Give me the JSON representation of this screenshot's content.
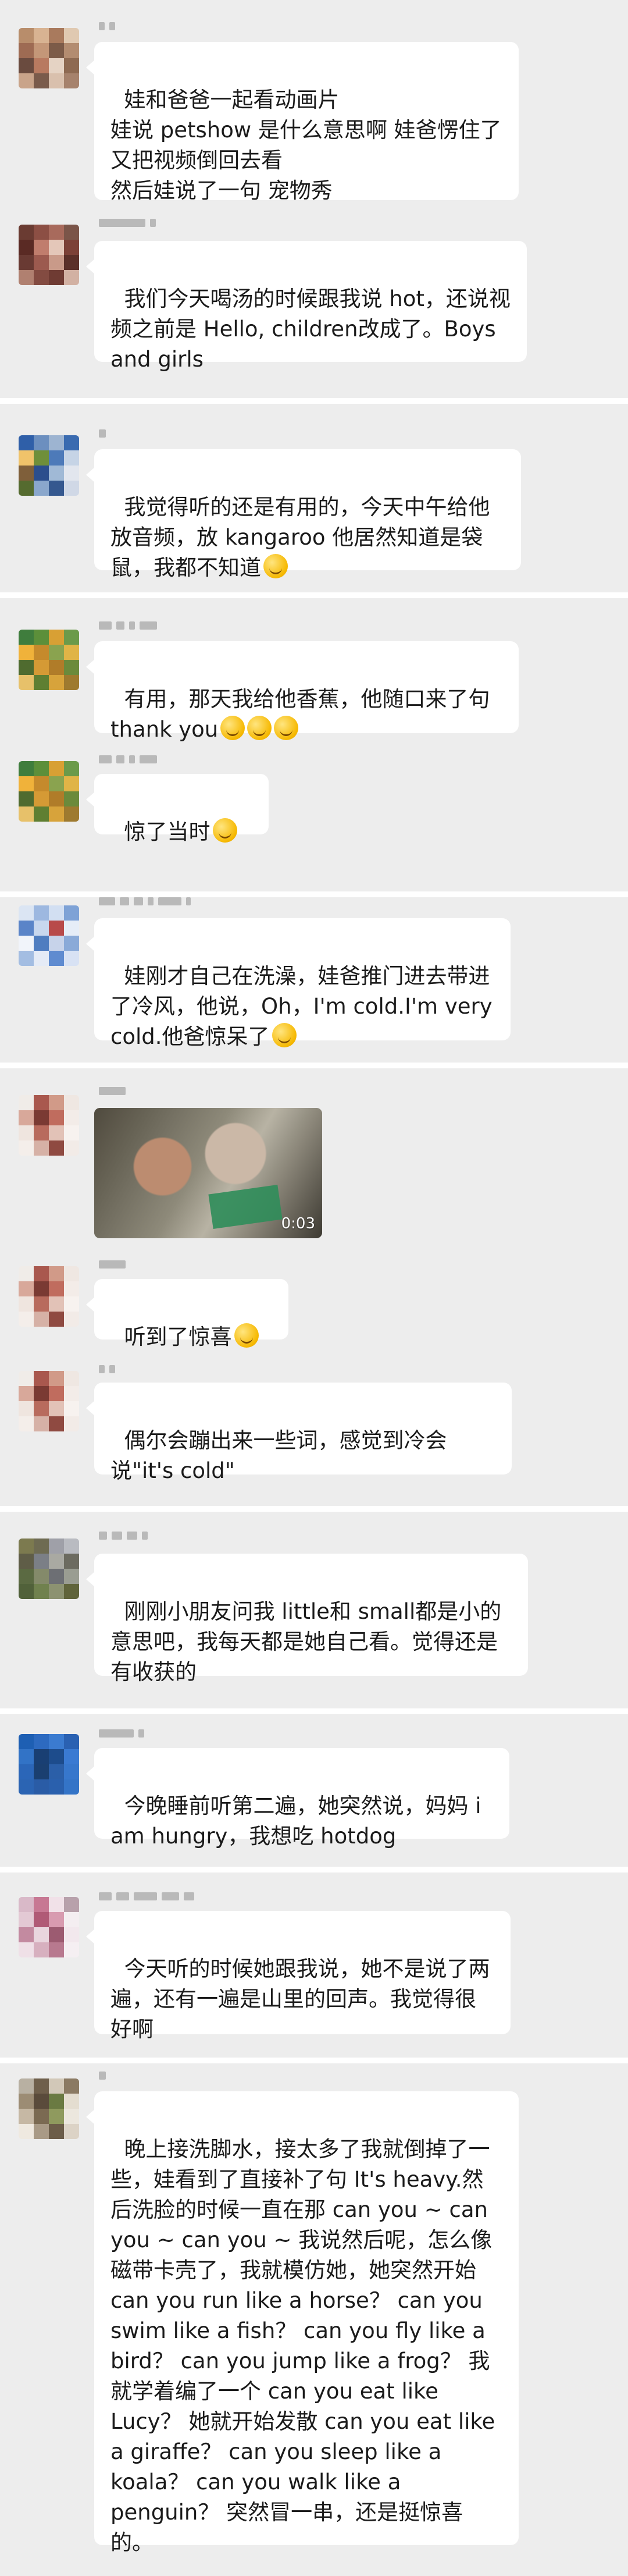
{
  "messages": [
    {
      "text": "娃和爸爸一起看动画片\n娃说 petshow 是什么意思啊 娃爸愣住了 又把视频倒回去看\n然后娃说了一句 宠物秀"
    },
    {
      "text": "我们今天喝汤的时候跟我说 hot，还说视频之前是 Hello, children改成了。Boys and girls"
    },
    {
      "text": "我觉得听的还是有用的，今天中午给他放音频，放 kangaroo 他居然知道是袋鼠，我都不知道",
      "emoji": "laugh-cry-emoji"
    },
    {
      "text": "有用，那天我给他香蕉，他随口来了句 thank you",
      "emoji": "laugh-cry-emoji"
    },
    {
      "text": "惊了当时",
      "emoji": "face-palm-emoji"
    },
    {
      "text": "娃刚才自己在洗澡，娃爸推门进去带进了冷风，他说，Oh，I'm cold.I'm very cold.他爸惊呆了",
      "emoji": "exploding-head-emoji"
    },
    {
      "video_duration": "0:03"
    },
    {
      "text": "听到了惊喜",
      "emoji": "grin-emoji"
    },
    {
      "text": "偶尔会蹦出来一些词，感觉到冷会说\"it's cold\""
    },
    {
      "text": "刚刚小朋友问我 little和 small都是小的意思吧，我每天都是她自己看。觉得还是有收获的"
    },
    {
      "text": "今晚睡前听第二遍，她突然说，妈妈 i am hungry，我想吃 hotdog"
    },
    {
      "text": "今天听的时候她跟我说，她不是说了两遍，还有一遍是山里的回声。我觉得很好啊"
    },
    {
      "text": "晚上接洗脚水，接太多了我就倒掉了一些，娃看到了直接补了句 It's heavy.然后洗脸的时候一直在那 can you ~ can you ~ can you ~ 我说然后呢，怎么像磁带卡壳了，我就模仿她，她突然开始 can you run like a horse？ can you swim like a fish？ can you fly like a bird？ can you jump like a frog？ 我就学着编了一个 can you eat like Lucy？ 她就开始发散 can you eat like a giraffe？ can you sleep like a koala？ can you walk like a penguin？ 突然冒一串，还是挺惊喜的。"
    }
  ]
}
